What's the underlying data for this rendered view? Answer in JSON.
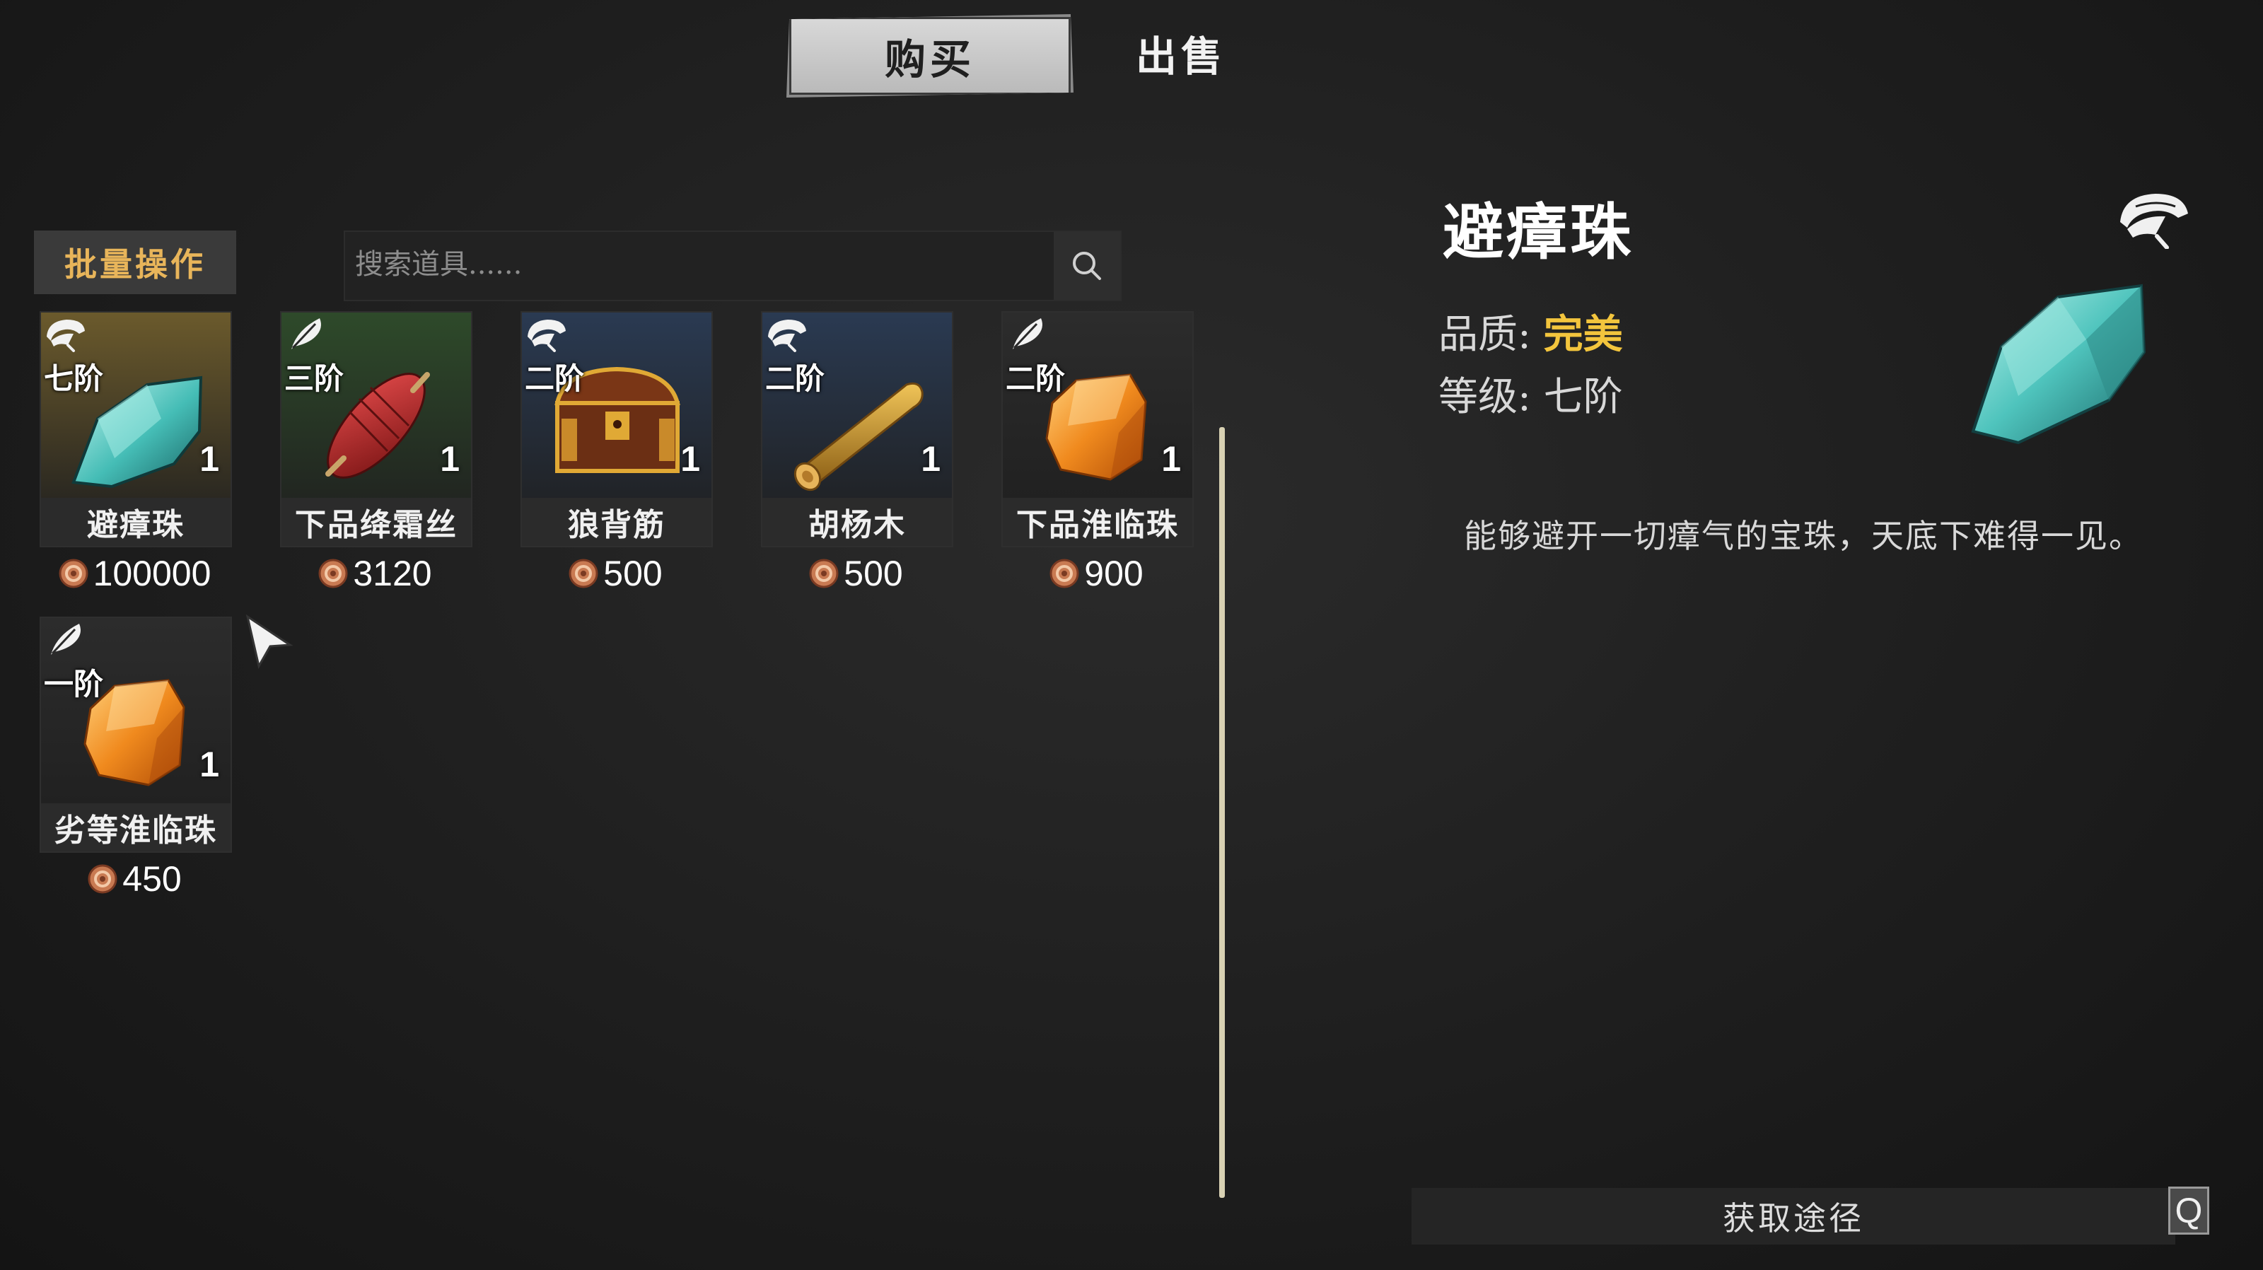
{
  "tabs": {
    "buy": "购买",
    "sell": "出售"
  },
  "toolbar": {
    "batch_label": "批量操作",
    "search_placeholder": "搜索道具......"
  },
  "items": [
    {
      "tier": "七阶",
      "quantity": "1",
      "name": "避瘴珠",
      "price": "100000",
      "bg_color": "#6b5a2c",
      "art": "teal-crystal"
    },
    {
      "tier": "三阶",
      "quantity": "1",
      "name": "下品绛霜丝",
      "price": "3120",
      "bg_color": "#2e4a2a",
      "art": "red-silk-spindle"
    },
    {
      "tier": "二阶",
      "quantity": "1",
      "name": "狼背筋",
      "price": "500",
      "bg_color": "#2a3a52",
      "art": "treasure-chest"
    },
    {
      "tier": "二阶",
      "quantity": "1",
      "name": "胡杨木",
      "price": "500",
      "bg_color": "#2a3a52",
      "art": "wood-log"
    },
    {
      "tier": "二阶",
      "quantity": "1",
      "name": "下品淮临珠",
      "price": "900",
      "bg_color": "#2c2c2c",
      "art": "orange-crystal"
    },
    {
      "tier": "一阶",
      "quantity": "1",
      "name": "劣等淮临珠",
      "price": "450",
      "bg_color": "#2c2c2c",
      "art": "orange-crystal"
    }
  ],
  "detail": {
    "title": "避瘴珠",
    "quality_label": "品质: ",
    "quality_value": "完美",
    "level_label": "等级: ",
    "level_value": "七阶",
    "description": "能够避开一切瘴气的宝珠，天底下难得一见。",
    "source_label": "获取途径",
    "hotkey": "Q"
  },
  "colors": {
    "accent_gold": "#e8b55a",
    "quality_perfect": "#f3c53d",
    "scrollbar": "#d8d1b3"
  }
}
